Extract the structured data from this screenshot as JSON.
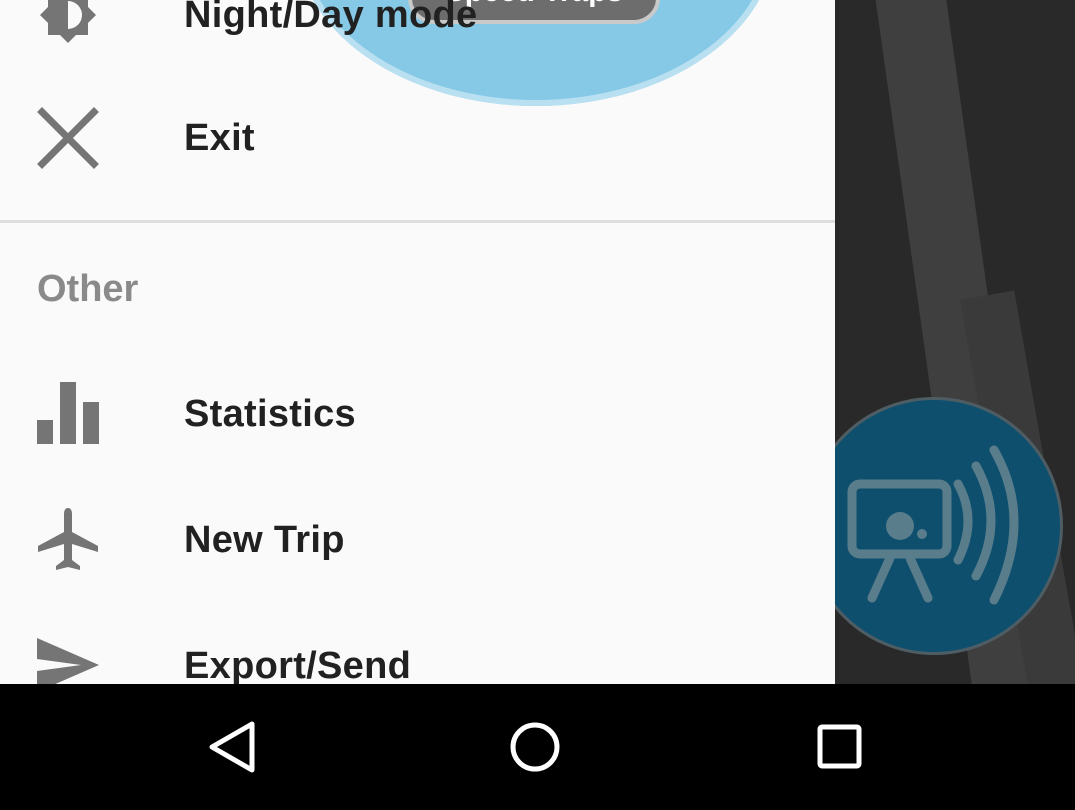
{
  "drawer": {
    "speed_traps_label": "Speed Traps",
    "items_top": [
      {
        "label": "Night/Day mode",
        "icon": "brightness-icon"
      },
      {
        "label": "Exit",
        "icon": "close-icon"
      }
    ],
    "section_header": "Other",
    "items_other": [
      {
        "label": "Statistics",
        "icon": "bar-chart-icon"
      },
      {
        "label": "New Trip",
        "icon": "airplane-icon"
      },
      {
        "label": "Export/Send",
        "icon": "send-icon"
      }
    ]
  },
  "map": {
    "fab_icon": "speed-camera-radar-icon"
  },
  "navbar": {
    "buttons": [
      "back-icon",
      "home-icon",
      "recents-icon"
    ]
  },
  "colors": {
    "drawer_bg": "#fafafa",
    "fab_bg": "#0e4f6e",
    "speed_traps_bubble": "#86c9e6"
  }
}
